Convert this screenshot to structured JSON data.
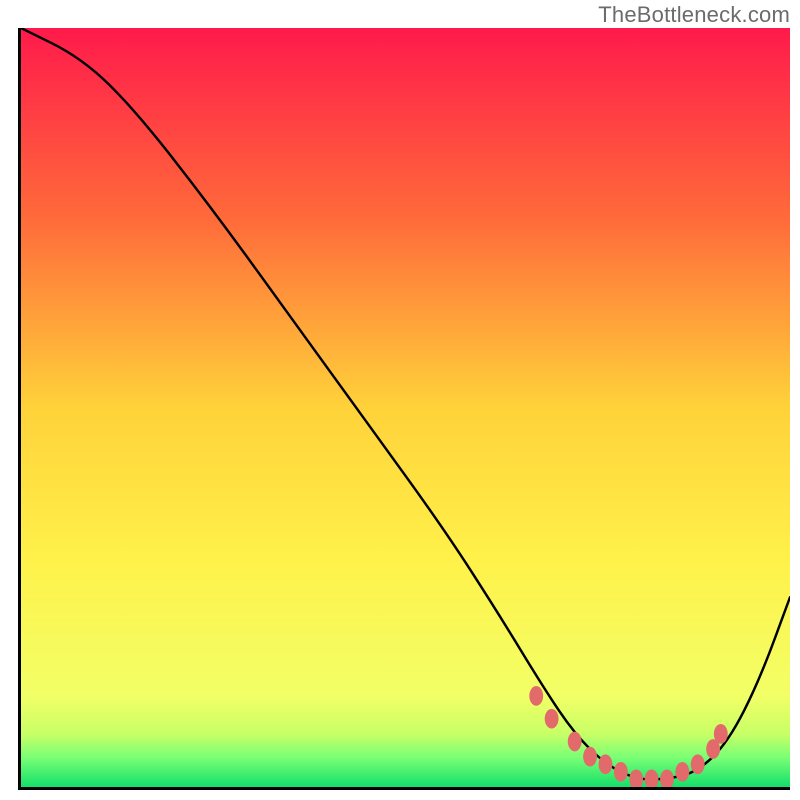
{
  "watermark": "TheBottleneck.com",
  "chart_data": {
    "type": "line",
    "title": "",
    "xlabel": "",
    "ylabel": "",
    "xlim": [
      0,
      100
    ],
    "ylim": [
      0,
      100
    ],
    "gradient_stops": [
      {
        "offset": 0,
        "color": "#ff1a4b"
      },
      {
        "offset": 25,
        "color": "#ff6a3a"
      },
      {
        "offset": 50,
        "color": "#ffd23a"
      },
      {
        "offset": 70,
        "color": "#fff14a"
      },
      {
        "offset": 88,
        "color": "#f2ff66"
      },
      {
        "offset": 93,
        "color": "#c8ff66"
      },
      {
        "offset": 96,
        "color": "#7dff75"
      },
      {
        "offset": 100,
        "color": "#13e06a"
      }
    ],
    "series": [
      {
        "name": "bottleneck-curve",
        "x": [
          0,
          8,
          15,
          25,
          35,
          45,
          55,
          62,
          68,
          72,
          76,
          80,
          84,
          88,
          92,
          96,
          100
        ],
        "values": [
          100,
          96,
          89,
          76,
          62,
          48,
          34,
          23,
          13,
          7,
          3,
          1,
          1,
          2,
          6,
          14,
          25
        ]
      }
    ],
    "markers": {
      "name": "highlight-dots",
      "x": [
        67,
        69,
        72,
        74,
        76,
        78,
        80,
        82,
        84,
        86,
        88,
        90,
        91
      ],
      "values": [
        12,
        9,
        6,
        4,
        3,
        2,
        1,
        1,
        1,
        2,
        3,
        5,
        7
      ],
      "color": "#e26a6a"
    }
  }
}
